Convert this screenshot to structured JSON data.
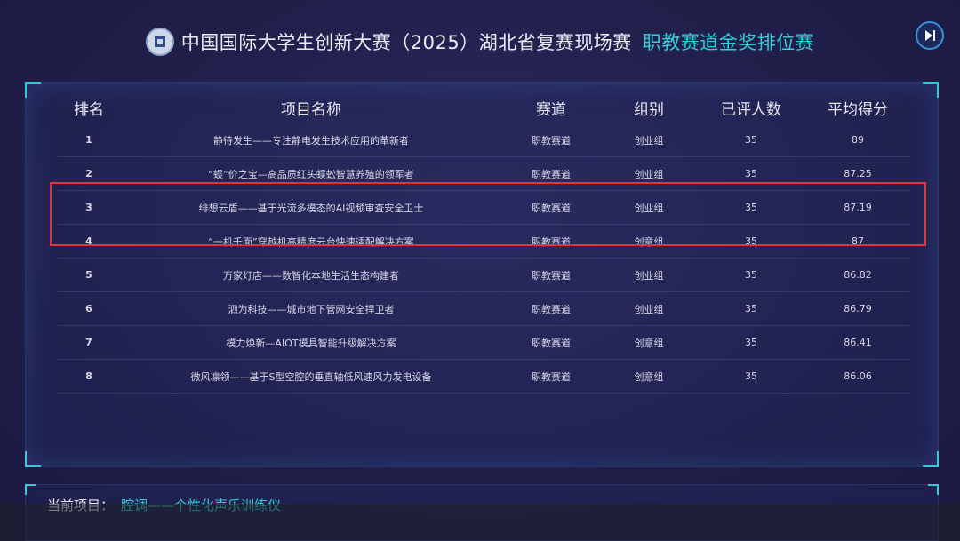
{
  "header": {
    "title": "中国国际大学生创新大赛（2025）湖北省复赛现场赛",
    "subtitle": "职教赛道金奖排位赛"
  },
  "icons": {
    "logo": "emblem-icon",
    "play": "skip-forward-icon"
  },
  "colors": {
    "accent": "#2fd0d8",
    "rank": "#3ad06a",
    "score": "#e03a52",
    "highlight": "#e0353d"
  },
  "table": {
    "headers": [
      "排名",
      "项目名称",
      "赛道",
      "组别",
      "已评人数",
      "平均得分"
    ],
    "rows": [
      {
        "rank": "1",
        "name": "静待发生——专注静电发生技术应用的革新者",
        "track": "职教赛道",
        "group": "创业组",
        "count": "35",
        "score": "89"
      },
      {
        "rank": "2",
        "name": "“蜈”价之宝—高品质红头蜈蚣智慧养殖的领军者",
        "track": "职教赛道",
        "group": "创业组",
        "count": "35",
        "score": "87.25"
      },
      {
        "rank": "3",
        "name": "绯想云盾——基于光流多模态的AI视频审查安全卫士",
        "track": "职教赛道",
        "group": "创业组",
        "count": "35",
        "score": "87.19"
      },
      {
        "rank": "4",
        "name": "“一机千面”穿越机高精度云台快速适配解决方案",
        "track": "职教赛道",
        "group": "创意组",
        "count": "35",
        "score": "87"
      },
      {
        "rank": "5",
        "name": "万家灯店——数智化本地生活生态构建者",
        "track": "职教赛道",
        "group": "创业组",
        "count": "35",
        "score": "86.82"
      },
      {
        "rank": "6",
        "name": "泗为科技——城市地下管网安全捍卫者",
        "track": "职教赛道",
        "group": "创业组",
        "count": "35",
        "score": "86.79"
      },
      {
        "rank": "7",
        "name": "模力焕新—AIOT模具智能升级解决方案",
        "track": "职教赛道",
        "group": "创意组",
        "count": "35",
        "score": "86.41"
      },
      {
        "rank": "8",
        "name": "微风凛领——基于S型空腔的垂直轴低风速风力发电设备",
        "track": "职教赛道",
        "group": "创意组",
        "count": "35",
        "score": "86.06"
      }
    ]
  },
  "current": {
    "label": "当前项目：",
    "value": "腔调——个性化声乐训练仪"
  }
}
